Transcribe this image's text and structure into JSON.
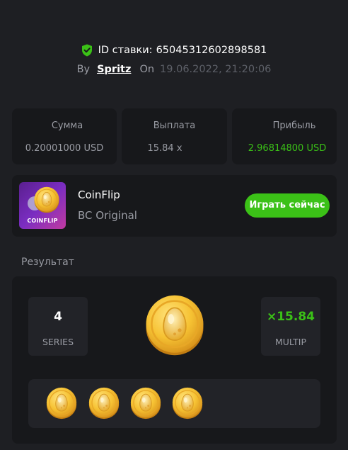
{
  "header": {
    "bet_id_label": "ID ставки:",
    "bet_id": "65045312602898581",
    "by_label": "By",
    "username": "Spritz",
    "on_label": "On",
    "datetime": "19.06.2022, 21:20:06"
  },
  "stats": [
    {
      "title": "Сумма",
      "value": "0.20001000 USD"
    },
    {
      "title": "Выплата",
      "value": "15.84 x"
    },
    {
      "title": "Прибыль",
      "value": "2.96814800 USD"
    }
  ],
  "game": {
    "name": "CoinFlip",
    "provider": "BC Original",
    "thumb_caption": "COINFLIP",
    "play_label": "Играть сейчас"
  },
  "result": {
    "title": "Результат",
    "series_value": "4",
    "series_label": "SERIES",
    "multiplier_value": "×15.84",
    "multiplier_label": "MULTIP",
    "history_count": 4
  },
  "colors": {
    "background": "#1e1f23",
    "panel": "#17181b",
    "accent_green": "#3bc117",
    "coin_gold": "#f0b72a"
  },
  "icons": [
    "shield-check-icon",
    "coin-icon"
  ]
}
